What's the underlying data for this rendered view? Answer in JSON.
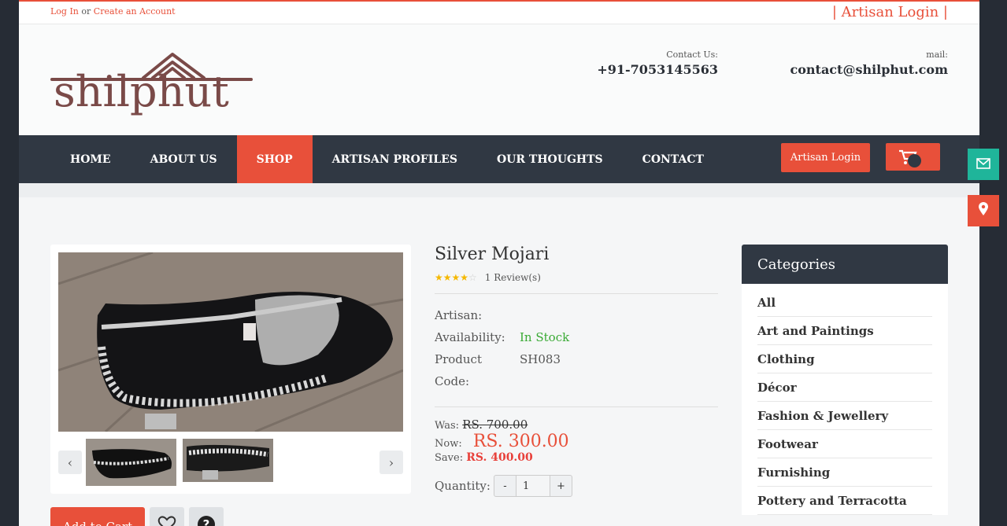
{
  "topbar": {
    "login": "Log In",
    "or": "or",
    "create": "Create an Account",
    "artisan_login": "| Artisan Login |"
  },
  "header": {
    "logo_text": "shilphut",
    "contact_label": "Contact Us:",
    "phone": "+91-7053145563",
    "mail_label": "mail:",
    "email": "contact@shilphut.com"
  },
  "nav": {
    "items": [
      "HOME",
      "ABOUT US",
      "SHOP",
      "ARTISAN PROFILES",
      "OUR THOUGHTS",
      "CONTACT"
    ],
    "active": "SHOP",
    "artisan_button": "Artisan Login"
  },
  "product": {
    "title": "Silver Mojari",
    "rating": 4,
    "reviews": "1 Review(s)",
    "artisan_label": "Artisan:",
    "artisan_value": "",
    "availability_label": "Availability:",
    "availability_value": "In Stock",
    "code_label": "Product Code:",
    "code_value": "SH083",
    "was_label": "Was:",
    "was_price": "RS. 700.00",
    "now_label": "Now:",
    "now_price": "RS. 300.00",
    "save_label": "Save:",
    "save_price": "RS. 400.00",
    "quantity_label": "Quantity:",
    "qty_minus": "-",
    "qty_value": "1",
    "qty_plus": "+",
    "add_to_cart": "Add to Cart"
  },
  "categories": {
    "title": "Categories",
    "items": [
      "All",
      "Art and Paintings",
      "Clothing",
      "Décor",
      "Fashion & Jewellery",
      "Footwear",
      "Furnishing",
      "Pottery and Terracotta"
    ]
  },
  "colors": {
    "accent": "#e8503a",
    "nav_bg": "#303843",
    "green": "#3aaa35",
    "teal": "#1fb59a"
  }
}
